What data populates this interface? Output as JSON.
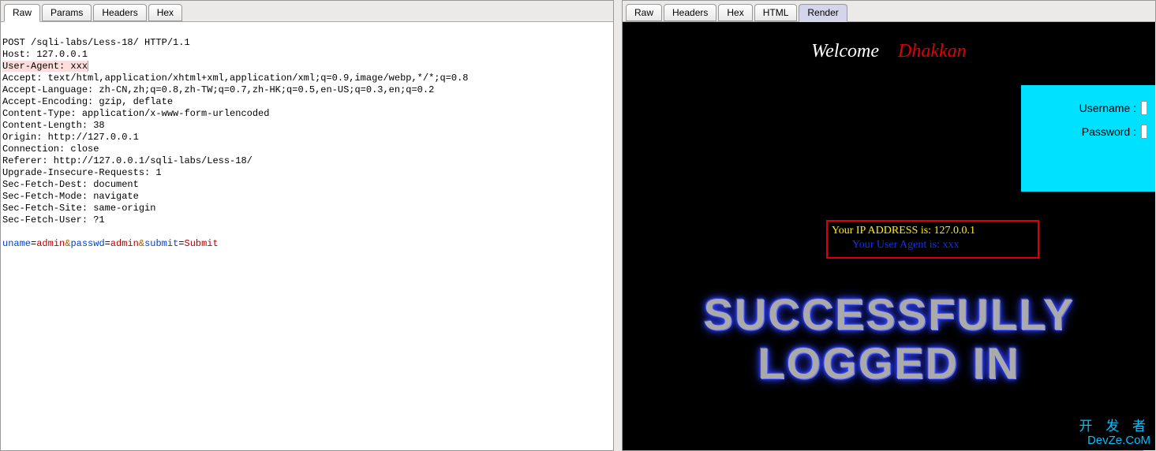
{
  "left": {
    "tabs": [
      "Raw",
      "Params",
      "Headers",
      "Hex"
    ],
    "active": 0,
    "request_lines": [
      "POST /sqli-labs/Less-18/ HTTP/1.1",
      "Host: 127.0.0.1",
      "User-Agent: xxx",
      "Accept: text/html,application/xhtml+xml,application/xml;q=0.9,image/webp,*/*;q=0.8",
      "Accept-Language: zh-CN,zh;q=0.8,zh-TW;q=0.7,zh-HK;q=0.5,en-US;q=0.3,en;q=0.2",
      "Accept-Encoding: gzip, deflate",
      "Content-Type: application/x-www-form-urlencoded",
      "Content-Length: 38",
      "Origin: http://127.0.0.1",
      "Connection: close",
      "Referer: http://127.0.0.1/sqli-labs/Less-18/",
      "Upgrade-Insecure-Requests: 1",
      "Sec-Fetch-Dest: document",
      "Sec-Fetch-Mode: navigate",
      "Sec-Fetch-Site: same-origin",
      "Sec-Fetch-User: ?1"
    ],
    "highlight_index": 2,
    "body": {
      "p1": "uname",
      "v1": "admin",
      "p2": "passwd",
      "v2": "admin",
      "p3": "submit",
      "v3": "Submit"
    }
  },
  "right": {
    "tabs": [
      "Raw",
      "Headers",
      "Hex",
      "HTML",
      "Render"
    ],
    "active": 4,
    "welcome1": "Welcome",
    "welcome2": "Dhakkan",
    "login_user_label": "Username :",
    "login_pass_label": "Password :",
    "ip_line": "Your IP ADDRESS is: 127.0.0.1",
    "ua_line": "Your User Agent is: xxx",
    "success_l1": "SUCCESSFULLY",
    "success_l2": "LOGGED IN",
    "watermark1": "开 发 者",
    "watermark2": "DevZe.CoM"
  }
}
